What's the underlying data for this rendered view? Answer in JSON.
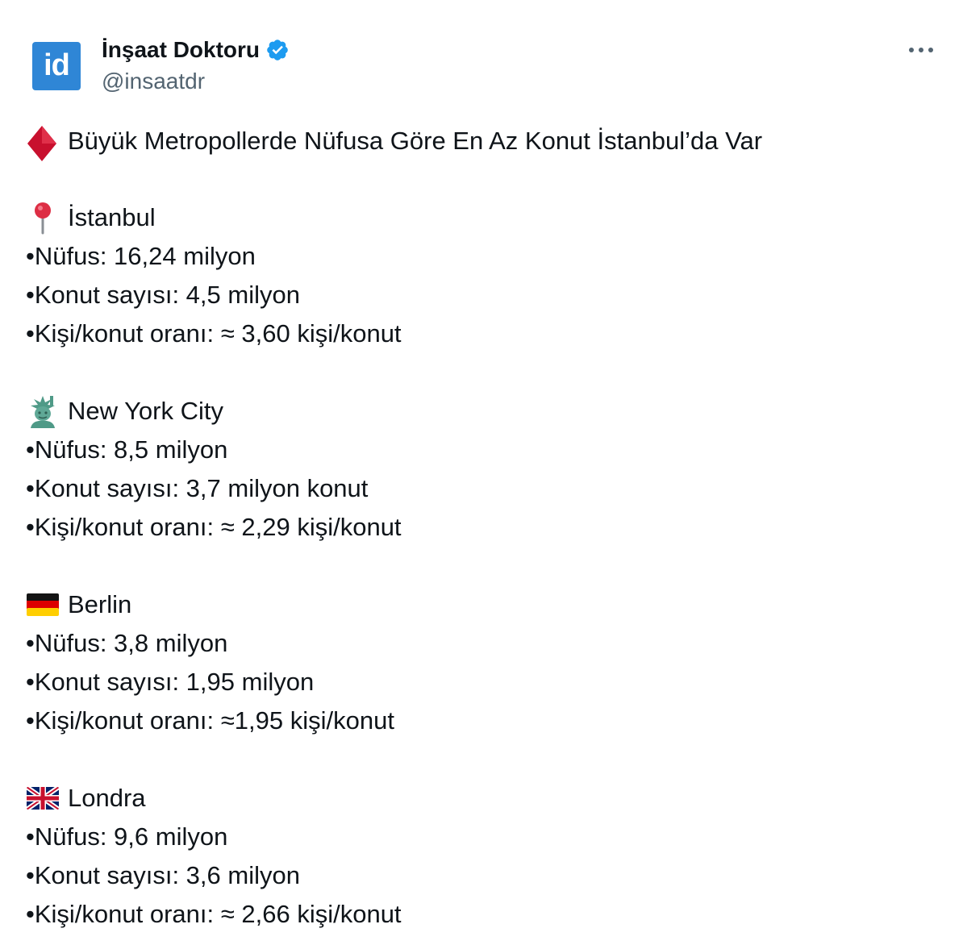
{
  "author": {
    "avatar_text": "id",
    "display_name": "İnşaat Doktoru",
    "handle": "@insaatdr",
    "verified_icon": "verified-badge-icon",
    "avatar_color": "#2f86d6",
    "verified_color": "#1d9bf0"
  },
  "menu": {
    "more_icon": "more-horizontal-icon"
  },
  "tweet": {
    "title_icon": "red-diamond-icon",
    "title": "Büyük Metropollerde Nüfusa Göre En Az Konut İstanbul’da Var",
    "cities": [
      {
        "icon": "round-pushpin-icon",
        "name": "İstanbul",
        "population": "•Nüfus: 16,24 milyon",
        "housing": "•Konut sayısı: 4,5 milyon",
        "ratio": "•Kişi/konut oranı: ≈ 3,60 kişi/konut"
      },
      {
        "icon": "statue-of-liberty-icon",
        "name": "New York City",
        "population": "•Nüfus: 8,5 milyon",
        "housing": "•Konut sayısı: 3,7 milyon konut",
        "ratio": "•Kişi/konut oranı: ≈ 2,29 kişi/konut"
      },
      {
        "icon": "germany-flag-icon",
        "name": "Berlin",
        "population": "•Nüfus: 3,8 milyon",
        "housing": "•Konut sayısı: 1,95 milyon",
        "ratio": "•Kişi/konut oranı: ≈1,95 kişi/konut"
      },
      {
        "icon": "united-kingdom-flag-icon",
        "name": "Londra",
        "population": "•Nüfus: 9,6 milyon",
        "housing": "•Konut sayısı: 3,6 milyon",
        "ratio": "•Kişi/konut oranı: ≈ 2,66 kişi/konut"
      }
    ]
  }
}
